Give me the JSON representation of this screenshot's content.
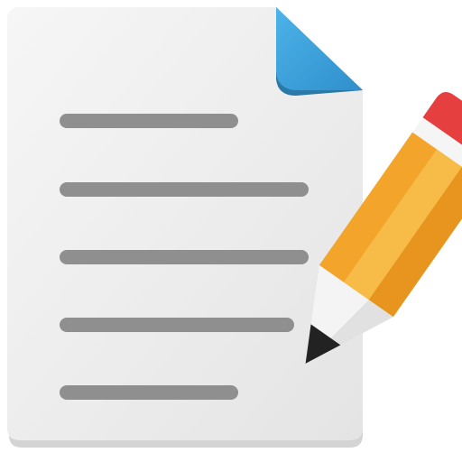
{
  "icon": {
    "name": "document-edit-icon",
    "parts": {
      "document": "document-page",
      "fold": "folded-corner",
      "lines": "text-lines",
      "pencil": "pencil"
    }
  },
  "colors": {
    "page": "#ececec",
    "page_shadow": "#cfcfcf",
    "fold": "#3a9fd8",
    "fold_shadow": "#2d7fb0",
    "text_line": "#8f8f8f",
    "pencil_body": "#f3a52b",
    "pencil_body_light": "#f7bc4a",
    "pencil_eraser": "#e53f3f",
    "pencil_ferrule": "#f3f3f3",
    "pencil_wood": "#f2f2f2",
    "pencil_lead": "#222222"
  }
}
